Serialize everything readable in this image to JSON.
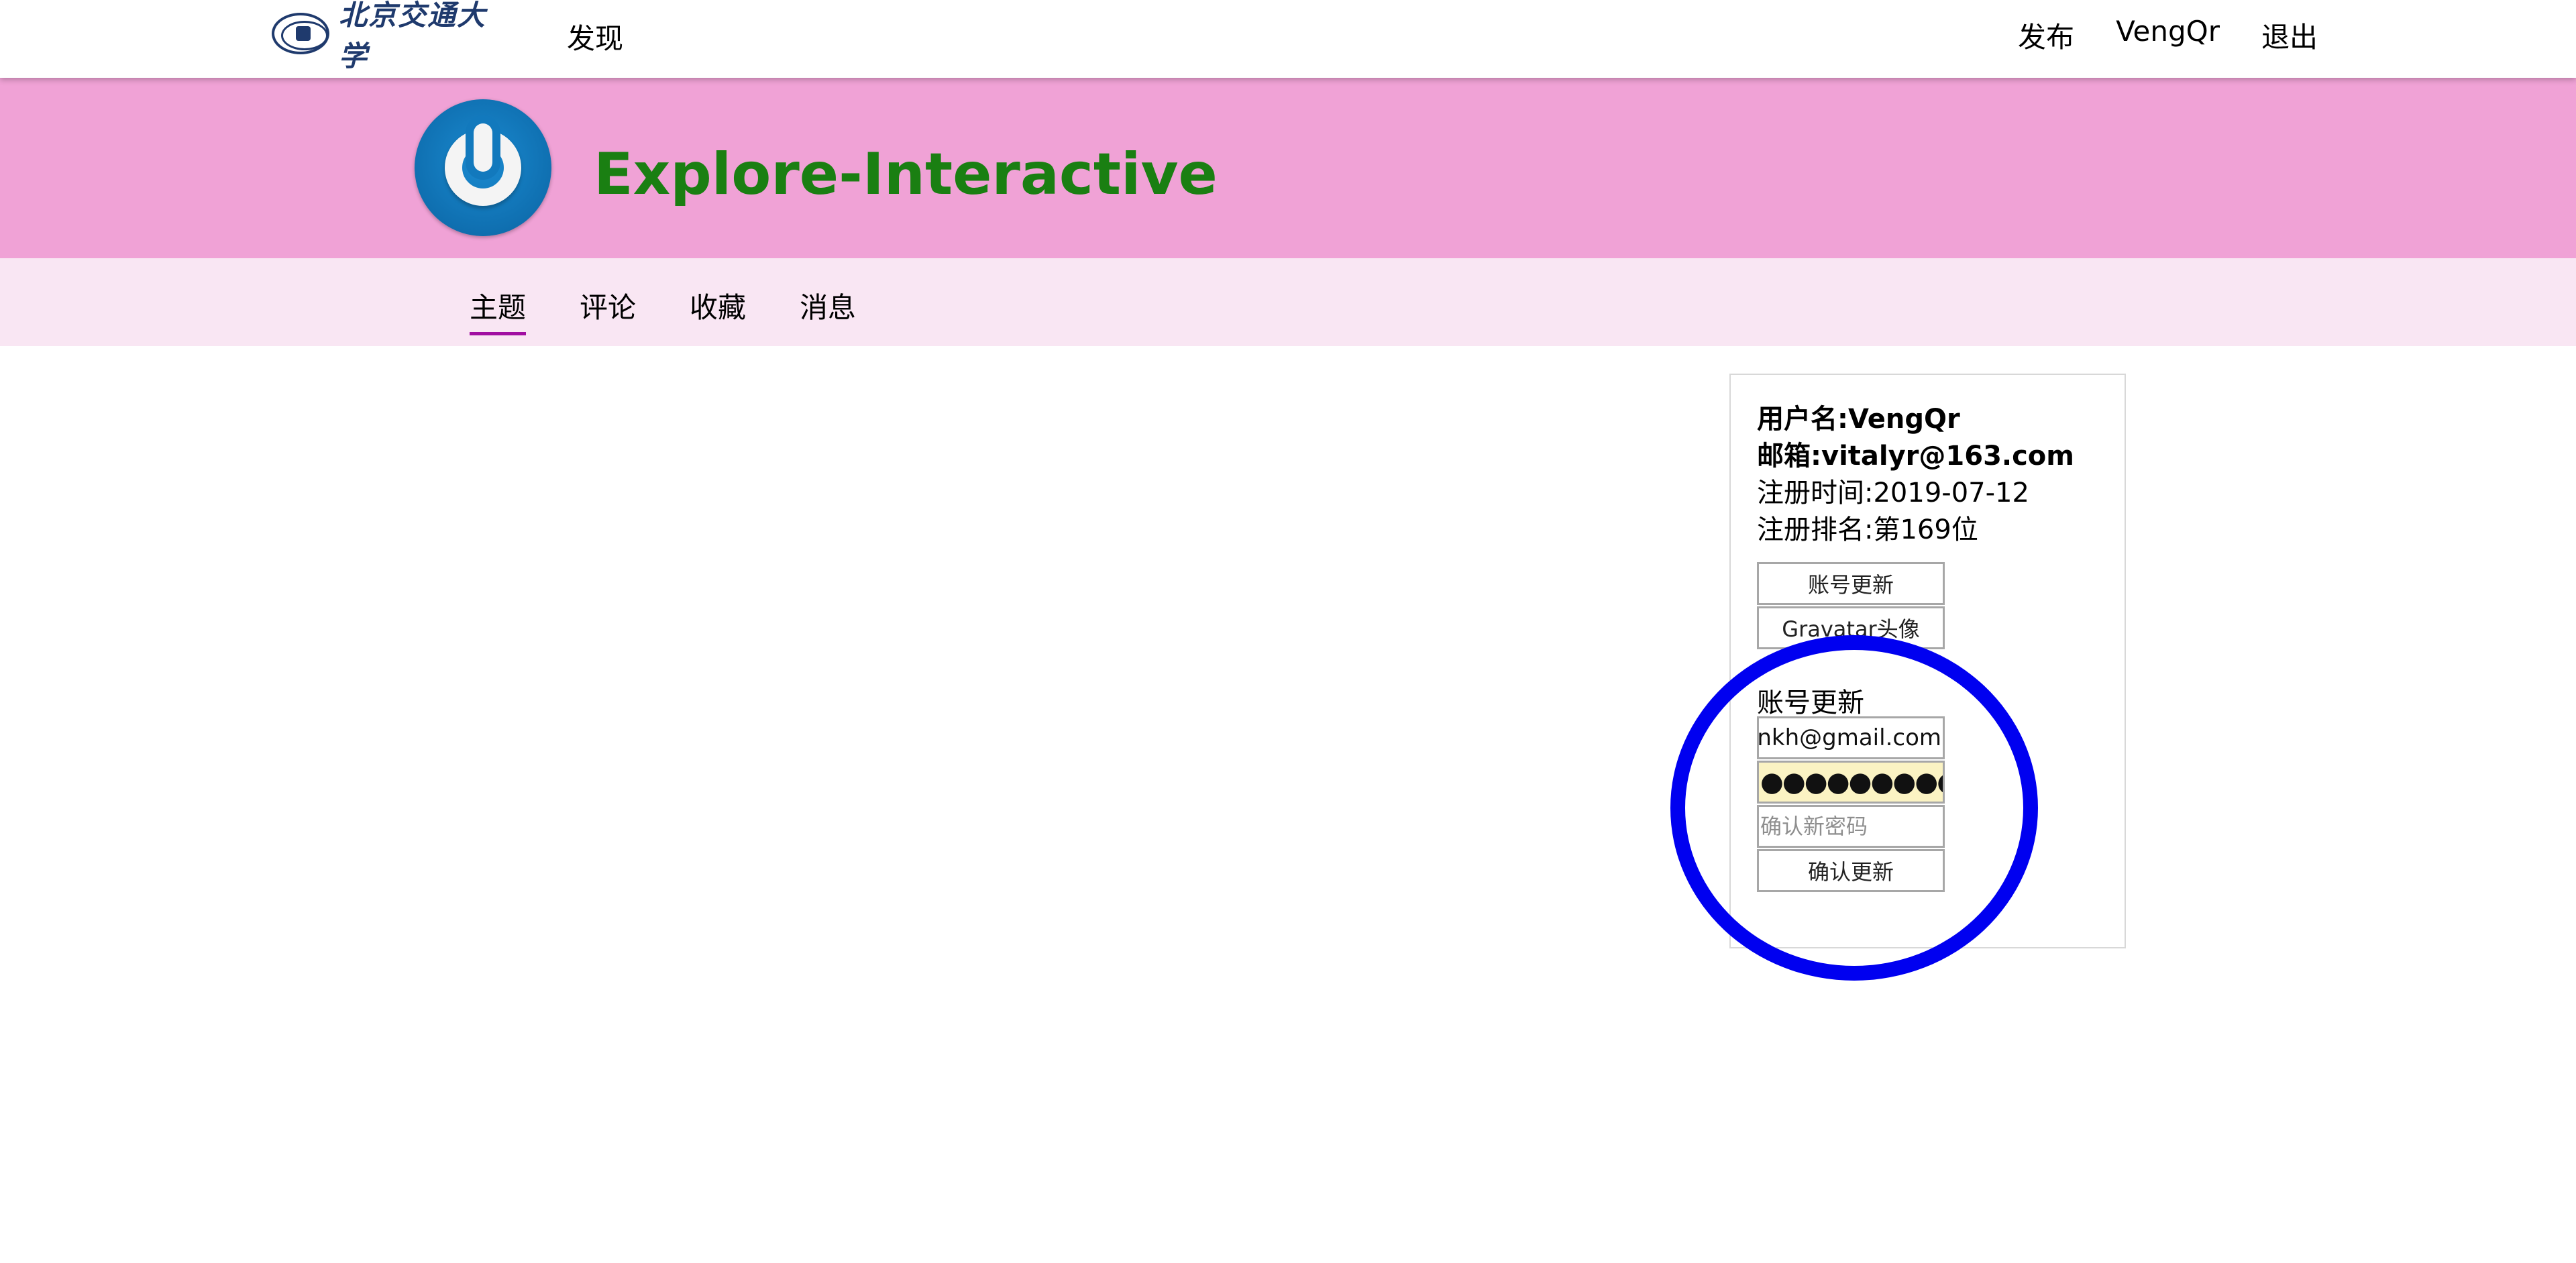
{
  "topbar": {
    "logo_text": "北京交通大学",
    "discover": "发现",
    "publish": "发布",
    "username": "VengQr",
    "logout": "退出"
  },
  "banner": {
    "title": "Explore-Interactive",
    "avatar_icon": "gravatar-power-icon",
    "bg_color": "#f0a2d6",
    "title_color": "#1a7f12"
  },
  "tabs": [
    {
      "label": "主题",
      "active": true
    },
    {
      "label": "评论",
      "active": false
    },
    {
      "label": "收藏",
      "active": false
    },
    {
      "label": "消息",
      "active": false
    }
  ],
  "profile": {
    "username_line": "用户名:VengQr",
    "email_line": "邮箱:vitalyr@163.com",
    "registered_line": "注册时间:2019-07-12",
    "rank_line": "注册排名:第169位",
    "account_update_btn": "账号更新",
    "gravatar_btn": "Gravatar头像"
  },
  "account_form": {
    "section_title": "账号更新",
    "email_value": "EmbraceAnkh@gmail.com",
    "password_value": "●●●●●●●●●●●",
    "confirm_placeholder": "确认新密码",
    "submit_label": "确认更新"
  }
}
